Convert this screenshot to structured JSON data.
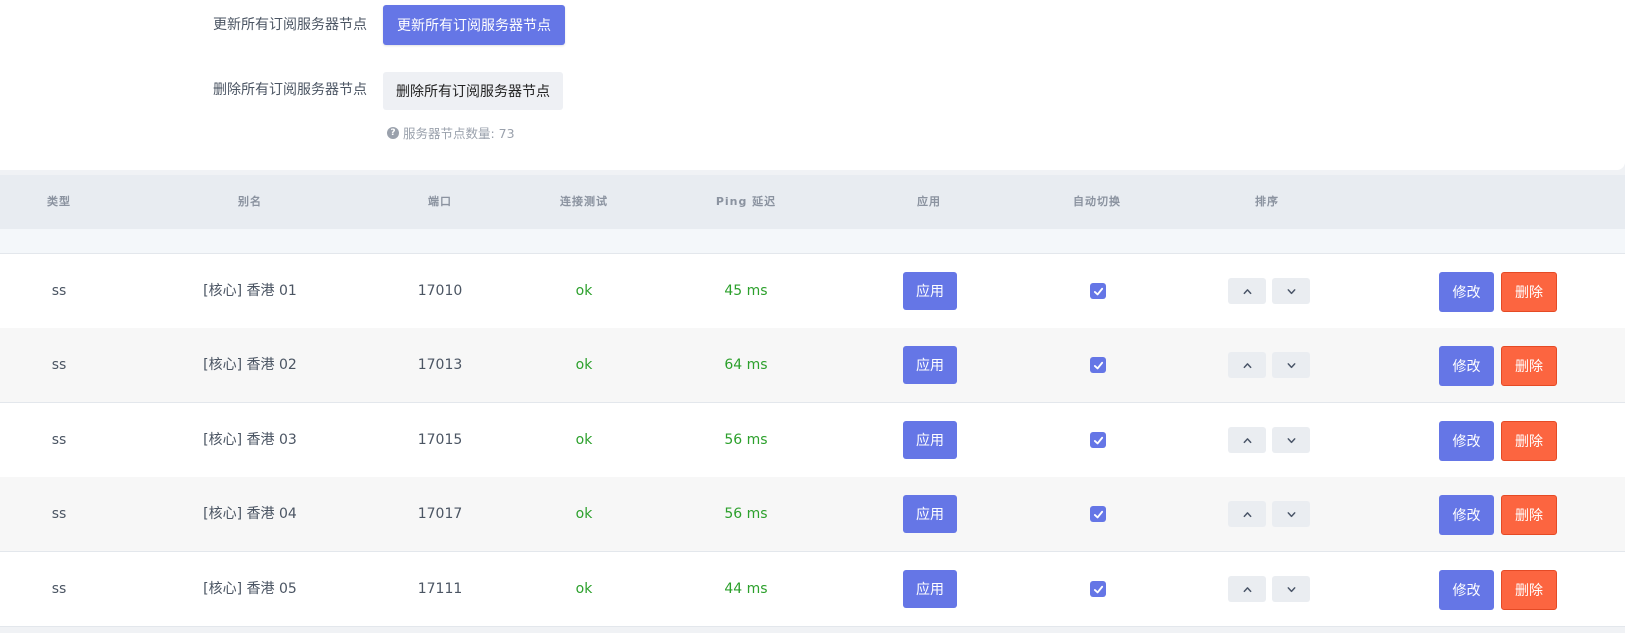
{
  "settings": {
    "update_label": "更新所有订阅服务器节点",
    "update_button": "更新所有订阅服务器节点",
    "delete_label": "删除所有订阅服务器节点",
    "delete_button": "删除所有订阅服务器节点",
    "node_count_hint": "服务器节点数量: 73"
  },
  "table": {
    "headers": [
      "类型",
      "别名",
      "端口",
      "连接测试",
      "Ping 延迟",
      "应用",
      "自动切换",
      "排序"
    ],
    "rows": [
      {
        "type": "ss",
        "alias": "[核心] 香港 01",
        "port": "17010",
        "test": "ok",
        "ping": "45 ms",
        "apply": "应用",
        "auto_switch": true,
        "edit": "修改",
        "delete": "删除"
      },
      {
        "type": "ss",
        "alias": "[核心] 香港 02",
        "port": "17013",
        "test": "ok",
        "ping": "64 ms",
        "apply": "应用",
        "auto_switch": true,
        "edit": "修改",
        "delete": "删除"
      },
      {
        "type": "ss",
        "alias": "[核心] 香港 03",
        "port": "17015",
        "test": "ok",
        "ping": "56 ms",
        "apply": "应用",
        "auto_switch": true,
        "edit": "修改",
        "delete": "删除"
      },
      {
        "type": "ss",
        "alias": "[核心] 香港 04",
        "port": "17017",
        "test": "ok",
        "ping": "56 ms",
        "apply": "应用",
        "auto_switch": true,
        "edit": "修改",
        "delete": "删除"
      },
      {
        "type": "ss",
        "alias": "[核心] 香港 05",
        "port": "17111",
        "test": "ok",
        "ping": "44 ms",
        "apply": "应用",
        "auto_switch": true,
        "edit": "修改",
        "delete": "删除"
      }
    ]
  },
  "colors": {
    "primary": "#6576e6",
    "danger": "#fc6540",
    "success": "#2ca02c"
  },
  "icons": {
    "hint": "question-circle-icon",
    "sort_up": "chevron-up-icon",
    "sort_down": "chevron-down-icon",
    "checkbox": "check-icon"
  }
}
